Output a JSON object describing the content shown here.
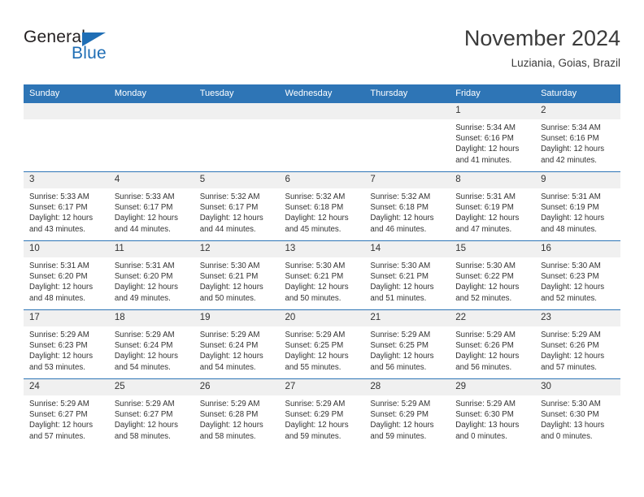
{
  "brand": {
    "name_top": "General",
    "name_bottom": "Blue",
    "accent_color": "#1f6eb5"
  },
  "header": {
    "title": "November 2024",
    "location": "Luziania, Goias, Brazil"
  },
  "theme": {
    "header_band": "#2e75b6",
    "daynum_bg": "#f0f0f0",
    "text": "#333333"
  },
  "calendar": {
    "weekday_headers": [
      "Sunday",
      "Monday",
      "Tuesday",
      "Wednesday",
      "Thursday",
      "Friday",
      "Saturday"
    ],
    "weeks": [
      [
        {
          "day": "",
          "lines": []
        },
        {
          "day": "",
          "lines": []
        },
        {
          "day": "",
          "lines": []
        },
        {
          "day": "",
          "lines": []
        },
        {
          "day": "",
          "lines": []
        },
        {
          "day": "1",
          "lines": [
            "Sunrise: 5:34 AM",
            "Sunset: 6:16 PM",
            "Daylight: 12 hours",
            "and 41 minutes."
          ]
        },
        {
          "day": "2",
          "lines": [
            "Sunrise: 5:34 AM",
            "Sunset: 6:16 PM",
            "Daylight: 12 hours",
            "and 42 minutes."
          ]
        }
      ],
      [
        {
          "day": "3",
          "lines": [
            "Sunrise: 5:33 AM",
            "Sunset: 6:17 PM",
            "Daylight: 12 hours",
            "and 43 minutes."
          ]
        },
        {
          "day": "4",
          "lines": [
            "Sunrise: 5:33 AM",
            "Sunset: 6:17 PM",
            "Daylight: 12 hours",
            "and 44 minutes."
          ]
        },
        {
          "day": "5",
          "lines": [
            "Sunrise: 5:32 AM",
            "Sunset: 6:17 PM",
            "Daylight: 12 hours",
            "and 44 minutes."
          ]
        },
        {
          "day": "6",
          "lines": [
            "Sunrise: 5:32 AM",
            "Sunset: 6:18 PM",
            "Daylight: 12 hours",
            "and 45 minutes."
          ]
        },
        {
          "day": "7",
          "lines": [
            "Sunrise: 5:32 AM",
            "Sunset: 6:18 PM",
            "Daylight: 12 hours",
            "and 46 minutes."
          ]
        },
        {
          "day": "8",
          "lines": [
            "Sunrise: 5:31 AM",
            "Sunset: 6:19 PM",
            "Daylight: 12 hours",
            "and 47 minutes."
          ]
        },
        {
          "day": "9",
          "lines": [
            "Sunrise: 5:31 AM",
            "Sunset: 6:19 PM",
            "Daylight: 12 hours",
            "and 48 minutes."
          ]
        }
      ],
      [
        {
          "day": "10",
          "lines": [
            "Sunrise: 5:31 AM",
            "Sunset: 6:20 PM",
            "Daylight: 12 hours",
            "and 48 minutes."
          ]
        },
        {
          "day": "11",
          "lines": [
            "Sunrise: 5:31 AM",
            "Sunset: 6:20 PM",
            "Daylight: 12 hours",
            "and 49 minutes."
          ]
        },
        {
          "day": "12",
          "lines": [
            "Sunrise: 5:30 AM",
            "Sunset: 6:21 PM",
            "Daylight: 12 hours",
            "and 50 minutes."
          ]
        },
        {
          "day": "13",
          "lines": [
            "Sunrise: 5:30 AM",
            "Sunset: 6:21 PM",
            "Daylight: 12 hours",
            "and 50 minutes."
          ]
        },
        {
          "day": "14",
          "lines": [
            "Sunrise: 5:30 AM",
            "Sunset: 6:21 PM",
            "Daylight: 12 hours",
            "and 51 minutes."
          ]
        },
        {
          "day": "15",
          "lines": [
            "Sunrise: 5:30 AM",
            "Sunset: 6:22 PM",
            "Daylight: 12 hours",
            "and 52 minutes."
          ]
        },
        {
          "day": "16",
          "lines": [
            "Sunrise: 5:30 AM",
            "Sunset: 6:23 PM",
            "Daylight: 12 hours",
            "and 52 minutes."
          ]
        }
      ],
      [
        {
          "day": "17",
          "lines": [
            "Sunrise: 5:29 AM",
            "Sunset: 6:23 PM",
            "Daylight: 12 hours",
            "and 53 minutes."
          ]
        },
        {
          "day": "18",
          "lines": [
            "Sunrise: 5:29 AM",
            "Sunset: 6:24 PM",
            "Daylight: 12 hours",
            "and 54 minutes."
          ]
        },
        {
          "day": "19",
          "lines": [
            "Sunrise: 5:29 AM",
            "Sunset: 6:24 PM",
            "Daylight: 12 hours",
            "and 54 minutes."
          ]
        },
        {
          "day": "20",
          "lines": [
            "Sunrise: 5:29 AM",
            "Sunset: 6:25 PM",
            "Daylight: 12 hours",
            "and 55 minutes."
          ]
        },
        {
          "day": "21",
          "lines": [
            "Sunrise: 5:29 AM",
            "Sunset: 6:25 PM",
            "Daylight: 12 hours",
            "and 56 minutes."
          ]
        },
        {
          "day": "22",
          "lines": [
            "Sunrise: 5:29 AM",
            "Sunset: 6:26 PM",
            "Daylight: 12 hours",
            "and 56 minutes."
          ]
        },
        {
          "day": "23",
          "lines": [
            "Sunrise: 5:29 AM",
            "Sunset: 6:26 PM",
            "Daylight: 12 hours",
            "and 57 minutes."
          ]
        }
      ],
      [
        {
          "day": "24",
          "lines": [
            "Sunrise: 5:29 AM",
            "Sunset: 6:27 PM",
            "Daylight: 12 hours",
            "and 57 minutes."
          ]
        },
        {
          "day": "25",
          "lines": [
            "Sunrise: 5:29 AM",
            "Sunset: 6:27 PM",
            "Daylight: 12 hours",
            "and 58 minutes."
          ]
        },
        {
          "day": "26",
          "lines": [
            "Sunrise: 5:29 AM",
            "Sunset: 6:28 PM",
            "Daylight: 12 hours",
            "and 58 minutes."
          ]
        },
        {
          "day": "27",
          "lines": [
            "Sunrise: 5:29 AM",
            "Sunset: 6:29 PM",
            "Daylight: 12 hours",
            "and 59 minutes."
          ]
        },
        {
          "day": "28",
          "lines": [
            "Sunrise: 5:29 AM",
            "Sunset: 6:29 PM",
            "Daylight: 12 hours",
            "and 59 minutes."
          ]
        },
        {
          "day": "29",
          "lines": [
            "Sunrise: 5:29 AM",
            "Sunset: 6:30 PM",
            "Daylight: 13 hours",
            "and 0 minutes."
          ]
        },
        {
          "day": "30",
          "lines": [
            "Sunrise: 5:30 AM",
            "Sunset: 6:30 PM",
            "Daylight: 13 hours",
            "and 0 minutes."
          ]
        }
      ]
    ]
  }
}
